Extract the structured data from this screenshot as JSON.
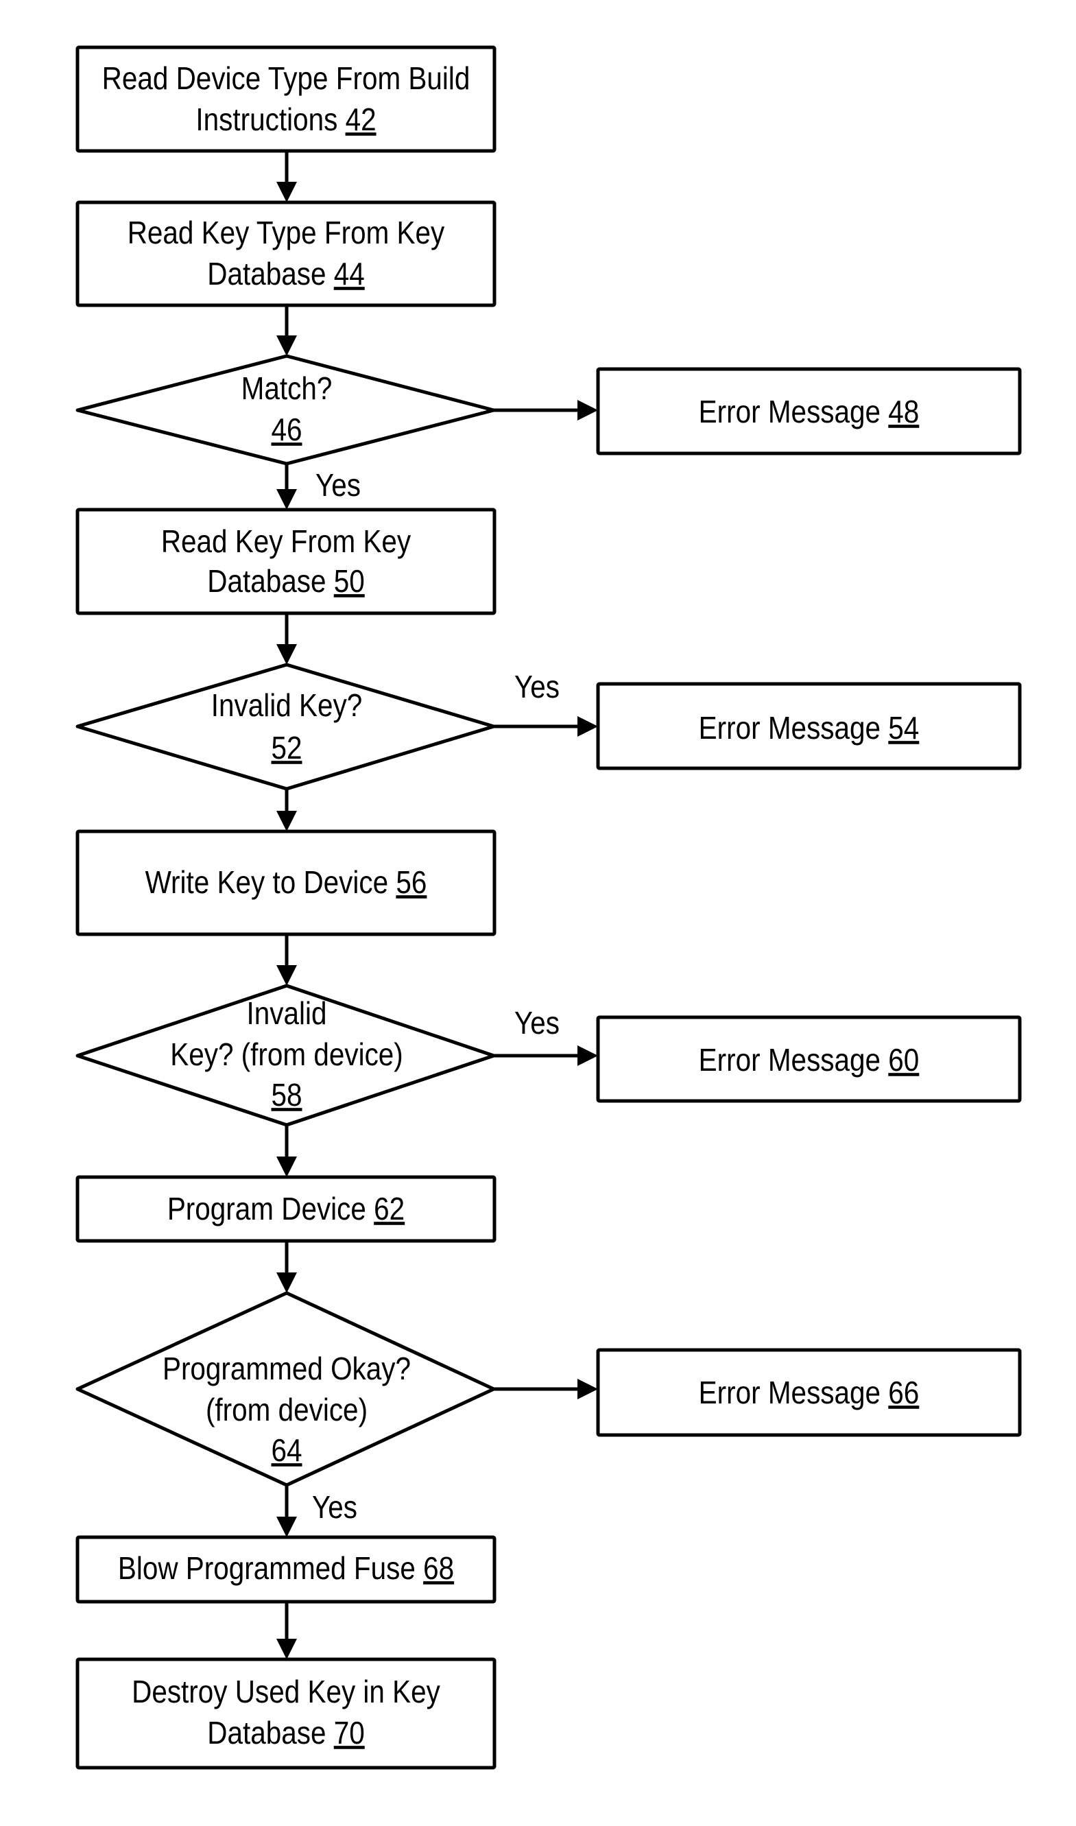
{
  "diagram": {
    "type": "flowchart",
    "colors": {
      "stroke": "#000000",
      "background": "#ffffff",
      "text": "#000000"
    },
    "nodes": [
      {
        "id": "n42",
        "shape": "process",
        "lines": [
          "Read Device Type From Build",
          "Instructions"
        ],
        "ref": "42"
      },
      {
        "id": "n44",
        "shape": "process",
        "lines": [
          "Read Key Type From Key",
          "Database"
        ],
        "ref": "44"
      },
      {
        "id": "n46",
        "shape": "decision",
        "lines": [
          "Match?"
        ],
        "ref": "46"
      },
      {
        "id": "n48",
        "shape": "process",
        "lines": [
          "Error Message"
        ],
        "ref": "48"
      },
      {
        "id": "n50",
        "shape": "process",
        "lines": [
          "Read Key From Key",
          "Database"
        ],
        "ref": "50"
      },
      {
        "id": "n52",
        "shape": "decision",
        "lines": [
          "Invalid Key?"
        ],
        "ref": "52"
      },
      {
        "id": "n54",
        "shape": "process",
        "lines": [
          "Error Message"
        ],
        "ref": "54"
      },
      {
        "id": "n56",
        "shape": "process",
        "lines": [
          "Write Key to Device"
        ],
        "ref": "56"
      },
      {
        "id": "n58",
        "shape": "decision",
        "lines": [
          "Invalid",
          "Key? (from device)"
        ],
        "ref": "58"
      },
      {
        "id": "n60",
        "shape": "process",
        "lines": [
          "Error Message"
        ],
        "ref": "60"
      },
      {
        "id": "n62",
        "shape": "process",
        "lines": [
          "Program Device"
        ],
        "ref": "62"
      },
      {
        "id": "n64",
        "shape": "decision",
        "lines": [
          "Programmed Okay?",
          "(from device)"
        ],
        "ref": "64"
      },
      {
        "id": "n66",
        "shape": "process",
        "lines": [
          "Error Message"
        ],
        "ref": "66"
      },
      {
        "id": "n68",
        "shape": "process",
        "lines": [
          "Blow Programmed Fuse"
        ],
        "ref": "68"
      },
      {
        "id": "n70",
        "shape": "process",
        "lines": [
          "Destroy Used Key in Key",
          "Database"
        ],
        "ref": "70"
      }
    ],
    "edges": [
      {
        "from": "n42",
        "to": "n44",
        "label": ""
      },
      {
        "from": "n44",
        "to": "n46",
        "label": ""
      },
      {
        "from": "n46",
        "to": "n48",
        "label": ""
      },
      {
        "from": "n46",
        "to": "n50",
        "label": "Yes"
      },
      {
        "from": "n50",
        "to": "n52",
        "label": ""
      },
      {
        "from": "n52",
        "to": "n54",
        "label": "Yes"
      },
      {
        "from": "n52",
        "to": "n56",
        "label": ""
      },
      {
        "from": "n56",
        "to": "n58",
        "label": ""
      },
      {
        "from": "n58",
        "to": "n60",
        "label": "Yes"
      },
      {
        "from": "n58",
        "to": "n62",
        "label": ""
      },
      {
        "from": "n62",
        "to": "n64",
        "label": ""
      },
      {
        "from": "n64",
        "to": "n66",
        "label": ""
      },
      {
        "from": "n64",
        "to": "n68",
        "label": "Yes"
      },
      {
        "from": "n68",
        "to": "n70",
        "label": ""
      }
    ]
  }
}
